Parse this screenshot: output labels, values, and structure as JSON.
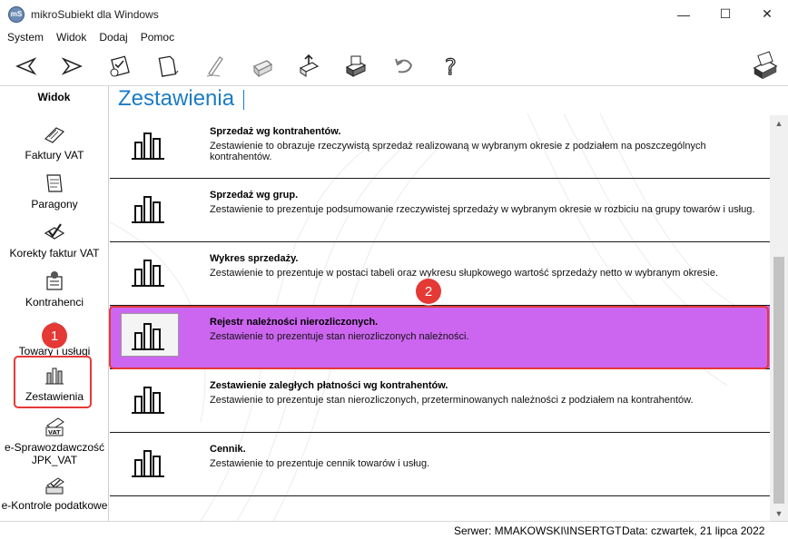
{
  "window": {
    "title": "mikroSubiekt dla Windows",
    "icon_label": "mS",
    "controls": {
      "minimize": "—",
      "maximize": "☐",
      "close": "✕"
    }
  },
  "menu": [
    "System",
    "Widok",
    "Dodaj",
    "Pomoc"
  ],
  "toolbar": {
    "buttons": [
      "back-arrow",
      "forward-arrow",
      "checklist",
      "new-document",
      "edit-pen",
      "printer",
      "export-arrow",
      "print-preview",
      "undo",
      "help"
    ],
    "help_glyph": "?"
  },
  "sidebar": {
    "title": "Widok",
    "items": [
      {
        "label": "Faktury VAT",
        "icon": "invoice-icon"
      },
      {
        "label": "Paragony",
        "icon": "receipt-icon"
      },
      {
        "label": "Korekty faktur VAT",
        "icon": "correction-icon"
      },
      {
        "label": "Kontrahenci",
        "icon": "contacts-icon"
      },
      {
        "label": "Towary i usługi",
        "icon": "goods-icon"
      },
      {
        "label": "Zestawienia",
        "icon": "reports-icon"
      },
      {
        "label": "e-Sprawozdawczość JPK_VAT",
        "line1": "e-Sprawozdawczość",
        "line2": "JPK_VAT",
        "icon": "vat-icon"
      },
      {
        "label": "e-Kontrole podatkowe",
        "icon": "tax-control-icon"
      }
    ]
  },
  "annotations": {
    "badge1": "1",
    "badge2": "2",
    "highlight_color": "#e53935"
  },
  "main": {
    "title": "Zestawienia",
    "reports": [
      {
        "title": "Sprzedaż wg kontrahentów.",
        "desc": "Zestawienie to obrazuje rzeczywistą sprzedaż realizowaną w wybranym okresie z podziałem na poszczególnych kontrahentów."
      },
      {
        "title": "Sprzedaż wg grup.",
        "desc": "Zestawienie to prezentuje podsumowanie rzeczywistej sprzedaży w wybranym okresie w rozbiciu na grupy towarów i usług."
      },
      {
        "title": "Wykres sprzedaży.",
        "desc": "Zestawienie to prezentuje w postaci tabeli oraz wykresu słupkowego wartość sprzedaży netto w wybranym okresie."
      },
      {
        "title": "Rejestr należności nierozliczonych.",
        "desc": "Zestawienie to prezentuje stan nierozliczonych należności.",
        "selected": true
      },
      {
        "title": "Zestawienie zaległych płatności wg kontrahentów.",
        "desc": "Zestawienie to prezentuje stan nierozliczonych, przeterminowanych należności z podziałem na kontrahentów."
      },
      {
        "title": "Cennik.",
        "desc": "Zestawienie to prezentuje cennik towarów i usług."
      }
    ],
    "selected_color": "#cc66f0",
    "title_color": "#1b7bc5"
  },
  "status": {
    "server": "Serwer: MMAKOWSKI\\INSERTGT",
    "date": "Data: czwartek, 21 lipca 2022"
  }
}
